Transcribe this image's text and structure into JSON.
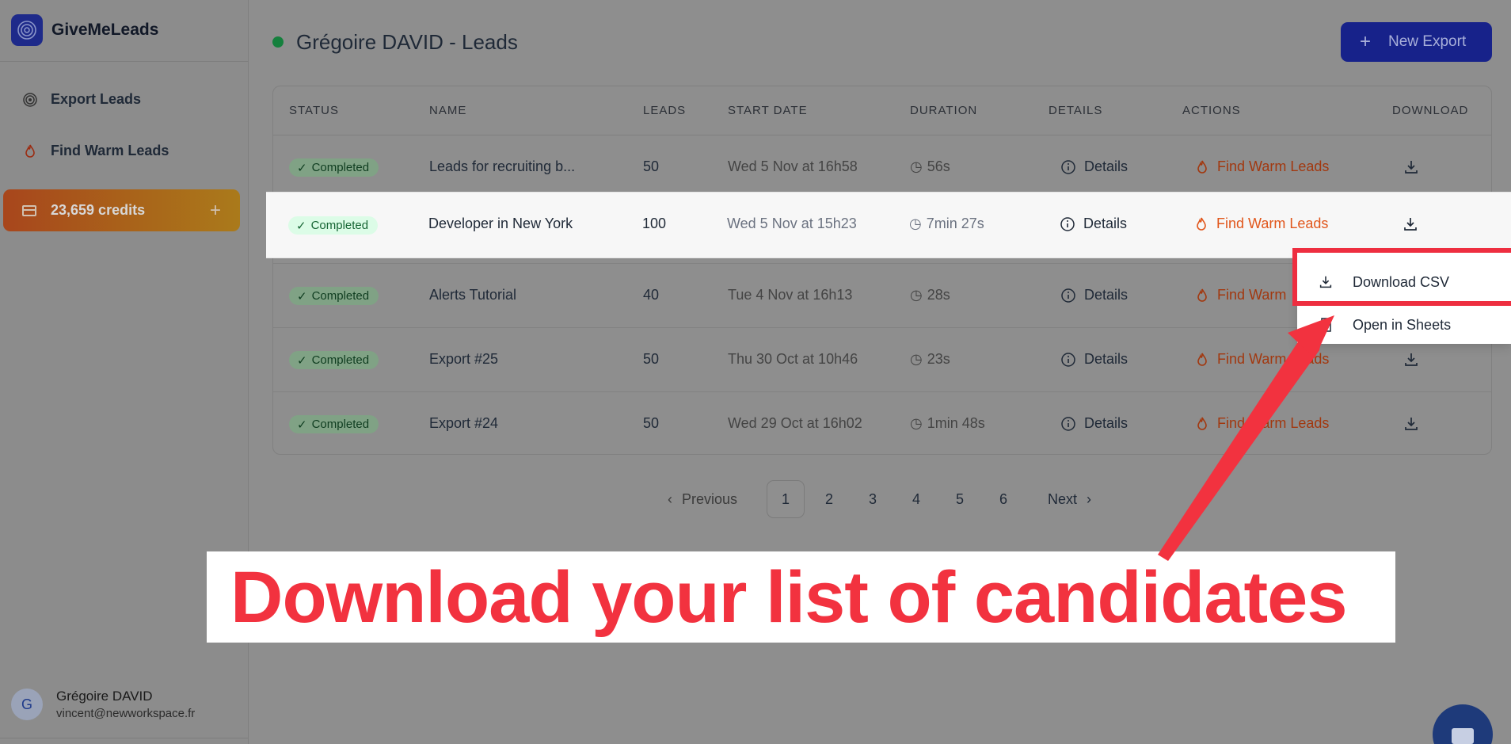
{
  "app": {
    "name": "GiveMeLeads"
  },
  "sidebar": {
    "items": [
      {
        "label": "Export Leads",
        "icon": "target-icon"
      },
      {
        "label": "Find Warm Leads",
        "icon": "flame-icon"
      }
    ],
    "credits": {
      "label": "23,659 credits",
      "plus": "+"
    },
    "user": {
      "initial": "G",
      "name": "Grégoire DAVID",
      "email": "vincent@newworkspace.fr"
    }
  },
  "header": {
    "title": "Grégoire DAVID - Leads",
    "new_export_label": "New Export",
    "plus": "+"
  },
  "table": {
    "columns": [
      "STATUS",
      "NAME",
      "LEADS",
      "START DATE",
      "DURATION",
      "DETAILS",
      "ACTIONS",
      "DOWNLOAD"
    ],
    "rows": [
      {
        "status": "Completed",
        "name": "Leads for recruiting b...",
        "leads": "50",
        "start": "Wed 5 Nov at 16h58",
        "duration": "56s",
        "details": "Details",
        "action": "Find Warm Leads"
      },
      {
        "status": "Completed",
        "name": "Developer in New York",
        "leads": "100",
        "start": "Wed 5 Nov at 15h23",
        "duration": "7min 27s",
        "details": "Details",
        "action": "Find Warm Leads"
      },
      {
        "status": "Completed",
        "name": "Alerts Tutorial",
        "leads": "40",
        "start": "Tue 4 Nov at 16h13",
        "duration": "28s",
        "details": "Details",
        "action": "Find Warm"
      },
      {
        "status": "Completed",
        "name": "Export #25",
        "leads": "50",
        "start": "Thu 30 Oct at 10h46",
        "duration": "23s",
        "details": "Details",
        "action": "Find Warm Leads"
      },
      {
        "status": "Completed",
        "name": "Export #24",
        "leads": "50",
        "start": "Wed 29 Oct at 16h02",
        "duration": "1min 48s",
        "details": "Details",
        "action": "Find Warm Leads"
      }
    ]
  },
  "download_menu": {
    "items": [
      {
        "label": "Download CSV"
      },
      {
        "label": "Open in Sheets"
      }
    ]
  },
  "pagination": {
    "previous": "Previous",
    "next": "Next",
    "pages": [
      "1",
      "2",
      "3",
      "4",
      "5",
      "6"
    ],
    "current": "1"
  },
  "annotation": {
    "text": "Download your list of candidates"
  },
  "colors": {
    "brand": "#1e2a8a",
    "accent_orange": "#e1561b",
    "annotation_red": "#f2323f",
    "status_green": "#dcfce7"
  }
}
